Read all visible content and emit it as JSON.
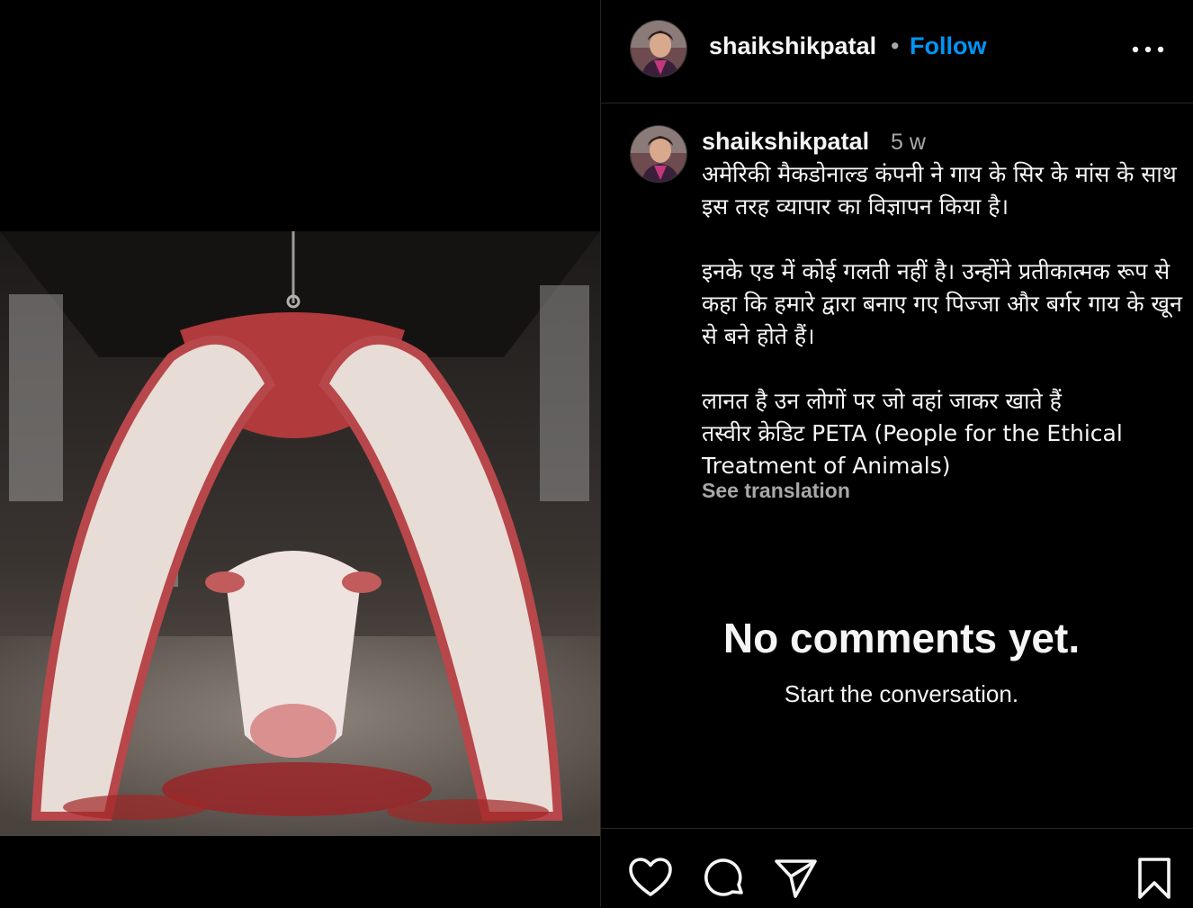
{
  "post": {
    "username": "shaikshikpatal",
    "follow_label": "Follow",
    "more_icon": "more-horizontal-icon",
    "image_subject": "cow-head-meat-sculpture"
  },
  "caption": {
    "username": "shaikshikpatal",
    "time_ago": "5 w",
    "text": "अमेरिकी मैकडोनाल्ड कंपनी ने गाय के सिर के मांस के साथ इस तरह व्यापार का विज्ञापन किया है।\n\nइनके एड में कोई गलती नहीं है। उन्होंने प्रतीकात्मक रूप से कहा कि हमारे द्वारा बनाए गए पिज्जा और बर्गर गाय के खून से बने होते हैं।\n\nलानत है उन लोगों पर जो वहां जाकर खाते हैं\nतस्वीर क्रेडिट PETA (People for the Ethical Treatment of Animals)",
    "see_translation": "See translation"
  },
  "comments": {
    "empty_title": "No comments yet.",
    "empty_subtitle": "Start the conversation."
  },
  "actions": {
    "like_icon": "heart-icon",
    "comment_icon": "comment-icon",
    "share_icon": "send-icon",
    "save_icon": "bookmark-icon"
  },
  "colors": {
    "background": "#000000",
    "text": "#f5f5f5",
    "secondary": "#a8a8a8",
    "link": "#0095f6",
    "divider": "#262626"
  }
}
